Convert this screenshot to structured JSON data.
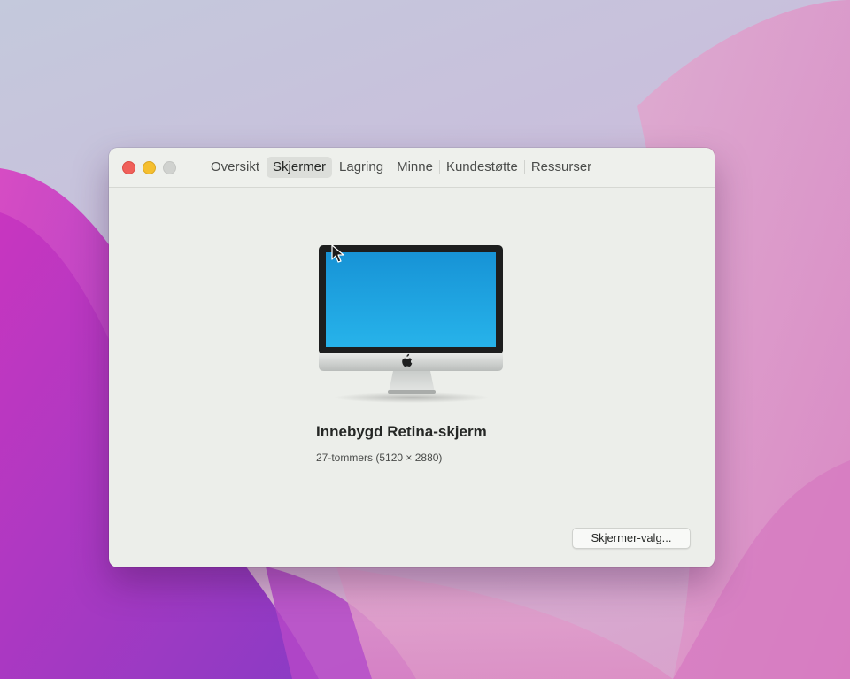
{
  "window": {
    "tabs": [
      {
        "label": "Oversikt",
        "active": false
      },
      {
        "label": "Skjermer",
        "active": true
      },
      {
        "label": "Lagring",
        "active": false
      },
      {
        "label": "Minne",
        "active": false
      },
      {
        "label": "Kundestøtte",
        "active": false
      },
      {
        "label": "Ressurser",
        "active": false
      }
    ],
    "traffic_lights": {
      "close_color": "#f0605a",
      "minimize_color": "#f5bf2f",
      "zoom_color": "#d0d2cf"
    }
  },
  "display": {
    "icon": "imac-icon",
    "name": "Innebygd Retina-skjerm",
    "spec": "27-tommers (5120 × 2880)"
  },
  "buttons": {
    "display_prefs_label": "Skjermer-valg..."
  }
}
